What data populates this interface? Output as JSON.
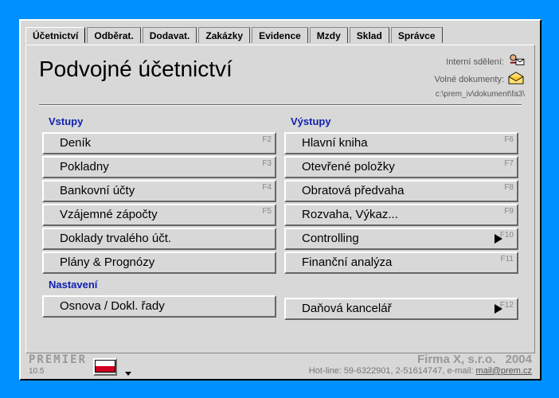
{
  "tabs": [
    {
      "id": "ucetnictvi",
      "label": "Účetnictví",
      "active": true
    },
    {
      "id": "odberat",
      "label": "Odběrat.",
      "active": false
    },
    {
      "id": "dodavat",
      "label": "Dodavat.",
      "active": false
    },
    {
      "id": "zakazky",
      "label": "Zakázky",
      "active": false
    },
    {
      "id": "evidence",
      "label": "Evidence",
      "active": false
    },
    {
      "id": "mzdy",
      "label": "Mzdy",
      "active": false
    },
    {
      "id": "sklad",
      "label": "Sklad",
      "active": false
    },
    {
      "id": "spravce",
      "label": "Správce",
      "active": false
    }
  ],
  "title": "Podvojné účetnictví",
  "header_right": {
    "interni": "Interní sdělení:",
    "volne": "Volné dokumenty:",
    "path": "c:\\prem_iv\\dokument\\fa3\\"
  },
  "sections": {
    "vstupy": {
      "title": "Vstupy",
      "items": [
        {
          "label": "Deník",
          "fkey": "F2",
          "arrow": false
        },
        {
          "label": "Pokladny",
          "fkey": "F3",
          "arrow": false
        },
        {
          "label": "Bankovní účty",
          "fkey": "F4",
          "arrow": false
        },
        {
          "label": "Vzájemné zápočty",
          "fkey": "F5",
          "arrow": false
        },
        {
          "label": "Doklady trvalého účt.",
          "fkey": "",
          "arrow": false
        },
        {
          "label": "Plány & Prognózy",
          "fkey": "",
          "arrow": false
        }
      ]
    },
    "vystupy": {
      "title": "Výstupy",
      "items": [
        {
          "label": "Hlavní kniha",
          "fkey": "F6",
          "arrow": false
        },
        {
          "label": "Otevřené položky",
          "fkey": "F7",
          "arrow": false
        },
        {
          "label": "Obratová předvaha",
          "fkey": "F8",
          "arrow": false
        },
        {
          "label": "Rozvaha, Výkaz...",
          "fkey": "F9",
          "arrow": false
        },
        {
          "label": "Controlling",
          "fkey": "F10",
          "arrow": true
        },
        {
          "label": "Finanční analýza",
          "fkey": "F11",
          "arrow": false
        }
      ]
    },
    "nastaveni": {
      "title": "Nastavení",
      "items": [
        {
          "label": "Osnova / Dokl. řady",
          "fkey": "",
          "arrow": false
        }
      ]
    },
    "danova": {
      "items": [
        {
          "label": "Daňová kancelář",
          "fkey": "F12",
          "arrow": true
        }
      ]
    }
  },
  "footer": {
    "logo": "PREMIER",
    "version": "10.5",
    "firm": "Firma X, s.r.o.",
    "year": "2004",
    "hotline_prefix": "Hot-line: 59-6322901, 2-51614747, e-mail: ",
    "mail": "mail@prem.cz"
  }
}
